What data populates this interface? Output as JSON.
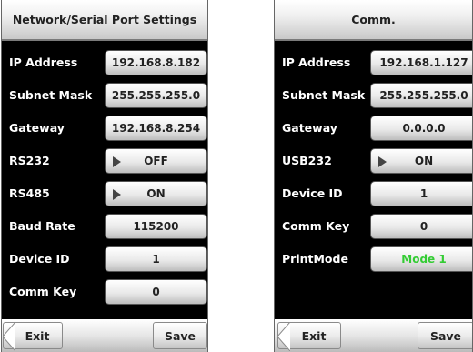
{
  "left": {
    "title": "Network/Serial Port Settings",
    "rows": [
      {
        "label": "IP Address",
        "value": "192.168.8.182"
      },
      {
        "label": "Subnet Mask",
        "value": "255.255.255.0"
      },
      {
        "label": "Gateway",
        "value": "192.168.8.254"
      },
      {
        "label": "RS232",
        "value": "OFF"
      },
      {
        "label": "RS485",
        "value": "ON"
      },
      {
        "label": "Baud Rate",
        "value": "115200"
      },
      {
        "label": "Device ID",
        "value": "1"
      },
      {
        "label": "Comm Key",
        "value": "0"
      }
    ],
    "exit_label": "Exit",
    "save_label": "Save"
  },
  "right": {
    "title": "Comm.",
    "rows": [
      {
        "label": "IP Address",
        "value": "192.168.1.127"
      },
      {
        "label": "Subnet Mask",
        "value": "255.255.255.0"
      },
      {
        "label": "Gateway",
        "value": "0.0.0.0"
      },
      {
        "label": "USB232",
        "value": "ON"
      },
      {
        "label": "Device ID",
        "value": "1"
      },
      {
        "label": "Comm Key",
        "value": "0"
      },
      {
        "label": "PrintMode",
        "value": "Mode 1"
      }
    ],
    "exit_label": "Exit",
    "save_label": "Save"
  },
  "colors": {
    "screen_bg": "#000000",
    "label_text": "#ffffff",
    "printmode_value": "#33cc33"
  },
  "icons": [
    "dropdown-triangle-icon",
    "back-arrow-icon"
  ]
}
